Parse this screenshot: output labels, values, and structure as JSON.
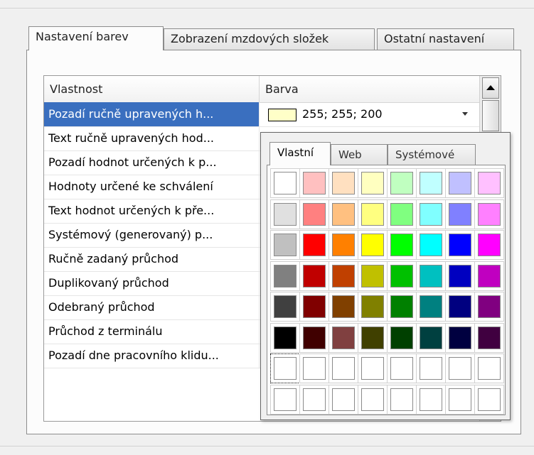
{
  "tabs": [
    "Nastavení barev",
    "Zobrazení mzdových složek",
    "Ostatní nastavení"
  ],
  "grid": {
    "col_property": "Vlastnost",
    "col_color": "Barva",
    "rows": [
      "Pozadí ručně upravených h...",
      "Text ručně upravených hod...",
      "Pozadí hodnot určených k p...",
      "Hodnoty určené ke schválení",
      "Text hodnot určených k pře...",
      "Systémový (generovaný) p...",
      "Ručně zadaný průchod",
      "Duplikovaný průchod",
      "Odebraný průchod",
      "Průchod z terminálu",
      "Pozadí dne pracovního klidu..."
    ],
    "selected_value": "255; 255; 200",
    "selected_color": "#ffffc8"
  },
  "picker": {
    "tabs": [
      "Vlastní",
      "Web",
      "Systémové"
    ],
    "colors": [
      [
        "#ffffff",
        "#ffc0c0",
        "#ffe0c0",
        "#ffffc0",
        "#c0ffc0",
        "#c0ffff",
        "#c0c0ff",
        "#ffc0ff"
      ],
      [
        "#e0e0e0",
        "#ff8080",
        "#ffc080",
        "#ffff80",
        "#80ff80",
        "#80ffff",
        "#8080ff",
        "#ff80ff"
      ],
      [
        "#c0c0c0",
        "#ff0000",
        "#ff8000",
        "#ffff00",
        "#00ff00",
        "#00ffff",
        "#0000ff",
        "#ff00ff"
      ],
      [
        "#808080",
        "#c00000",
        "#c04000",
        "#c0c000",
        "#00c000",
        "#00c0c0",
        "#0000c0",
        "#c000c0"
      ],
      [
        "#404040",
        "#800000",
        "#804000",
        "#808000",
        "#008000",
        "#008080",
        "#000080",
        "#800080"
      ],
      [
        "#000000",
        "#400000",
        "#804040",
        "#404000",
        "#004000",
        "#004040",
        "#000040",
        "#400040"
      ],
      [
        "#ffffff",
        "#ffffff",
        "#ffffff",
        "#ffffff",
        "#ffffff",
        "#ffffff",
        "#ffffff",
        "#ffffff"
      ],
      [
        "#ffffff",
        "#ffffff",
        "#ffffff",
        "#ffffff",
        "#ffffff",
        "#ffffff",
        "#ffffff",
        "#ffffff"
      ]
    ]
  }
}
